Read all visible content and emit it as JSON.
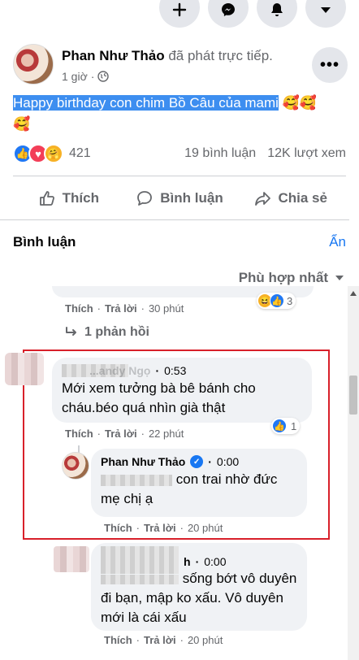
{
  "post": {
    "author": "Phan Như Thảo",
    "action": "đã phát trực tiếp.",
    "time": "1 giờ",
    "text": "Happy birthday con chim Bồ Câu của mami",
    "emoji": "🥰🥰",
    "emoji_line2": "🥰",
    "reaction_count": "421",
    "comment_count": "19 bình luận",
    "view_count": "12K lượt xem"
  },
  "actions": {
    "like": "Thích",
    "comment": "Bình luận",
    "share": "Chia sẻ"
  },
  "comments_section": {
    "title": "Bình luận",
    "hide": "Ẩn",
    "sort": "Phù hợp nhất"
  },
  "comments": [
    {
      "like": "Thích",
      "reply": "Trả lời",
      "time": "30 phút",
      "reaction_count": "3",
      "replies_label": "1 phản hồi"
    },
    {
      "name": "...andy Ngọ",
      "time_stamp": "0:53",
      "text": "Mới xem tưởng bà bê bánh cho cháu.béo quá nhìn già thật",
      "like": "Thích",
      "reply": "Trả lời",
      "time": "22 phút",
      "reaction_count": "1"
    },
    {
      "name": "Phan Như Thảo",
      "time_stamp": "0:00",
      "text": "con trai nhờ đức mẹ chị ạ",
      "like": "Thích",
      "reply": "Trả lời",
      "time": "20 phút"
    },
    {
      "name": "h",
      "time_stamp": "0:00",
      "text_part1": "sống bớt vô",
      "text_part2": "duyên đi bạn, mập ko xấu. Vô duyên mới là cái xấu",
      "like": "Thích",
      "reply": "Trả lời",
      "time": "20 phút"
    }
  ],
  "colors": {
    "accent": "#1877f2",
    "highlight_box": "#d8202a",
    "text_highlight": "#3d8ef0"
  }
}
